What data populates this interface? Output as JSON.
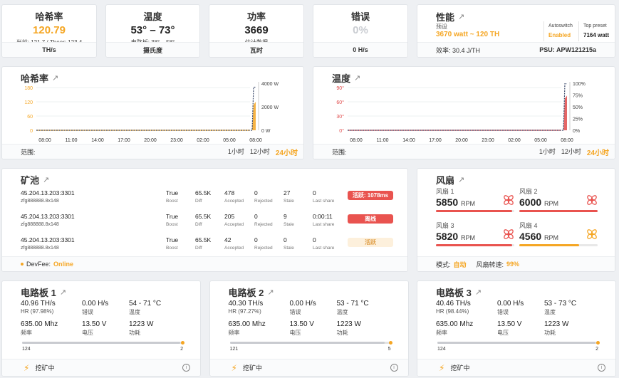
{
  "stats": {
    "hashrate": {
      "title": "哈希率",
      "value": "120.79",
      "sub": "当前: 121.7 / Theor: 123.4",
      "unit": "TH/s"
    },
    "temperature": {
      "title": "温度",
      "value": "53° – 73°",
      "sub": "电路板: 38° – 58°",
      "unit": "摄氏度"
    },
    "power": {
      "title": "功率",
      "value": "3669",
      "sub": "估计数据",
      "unit": "瓦时"
    },
    "errors": {
      "title": "错误",
      "value": "0%",
      "unit": "0 H/s"
    },
    "performance": {
      "title": "性能",
      "preset_label": "预设",
      "preset_value": "3670 watt ~ 120 TH",
      "autoswitch_label": "Autoswitch",
      "autoswitch_value": "Enabled",
      "top_preset_label": "Top preset",
      "top_preset_value": "7164 watt",
      "efficiency": "效率: 30.4 J/TH",
      "psu": "PSU: APW121215a"
    }
  },
  "charts": {
    "hashrate": {
      "title": "哈希率",
      "range_label": "范围:",
      "ranges": [
        "1小时",
        "12小时",
        "24小时"
      ],
      "active_range": "24小时"
    },
    "temperature": {
      "title": "温度",
      "range_label": "范围:",
      "ranges": [
        "1小时",
        "12小时",
        "24小时"
      ],
      "active_range": "24小时"
    }
  },
  "chart_data": [
    {
      "type": "line",
      "x": [
        "08:00",
        "11:00",
        "14:00",
        "17:00",
        "20:00",
        "23:00",
        "02:00",
        "05:00",
        "08:00"
      ],
      "left_ticks": [
        "180",
        "120",
        "60",
        "0"
      ],
      "right_ticks": [
        "4000 W",
        "2000 W",
        "0 W"
      ],
      "ylim_left": [
        0,
        180
      ],
      "ylim_right": [
        0,
        4000
      ],
      "series": [
        {
          "values": [
            0,
            0,
            0,
            0,
            0,
            0,
            0,
            0,
            120
          ],
          "color": "#f5a623"
        },
        {
          "values": [
            0,
            0,
            0,
            0,
            0,
            0,
            0,
            0,
            3669
          ],
          "color": "#3b4a6b"
        }
      ]
    },
    {
      "type": "line",
      "x": [
        "08:00",
        "11:00",
        "14:00",
        "17:00",
        "20:00",
        "23:00",
        "02:00",
        "05:00",
        "08:00"
      ],
      "left_ticks": [
        "90°",
        "60°",
        "30°",
        "0°"
      ],
      "right_ticks": [
        "100%",
        "75%",
        "50%",
        "25%",
        "0%"
      ],
      "ylim_left": [
        0,
        90
      ],
      "ylim_right": [
        0,
        100
      ],
      "series": [
        {
          "values": [
            0,
            0,
            0,
            0,
            0,
            0,
            0,
            0,
            73
          ],
          "color": "#e04b4b"
        },
        {
          "values": [
            0,
            0,
            0,
            0,
            0,
            0,
            0,
            0,
            99
          ],
          "color": "#3b4a6b"
        }
      ]
    }
  ],
  "pools": {
    "title": "矿池",
    "col_labels": {
      "boost": "Boost",
      "diff": "Diff",
      "accepted": "Accepted",
      "rejected": "Rejected",
      "stale": "Stale",
      "last_share": "Last share"
    },
    "rows": [
      {
        "url": "45.204.13.203:3301",
        "user": "zfg888888.8x148",
        "boost": "True",
        "diff": "65.5K",
        "accepted": "478",
        "rejected": "0",
        "stale": "27",
        "last_share": "0",
        "status": "活跃: 1078ms",
        "status_color": "#e9534f"
      },
      {
        "url": "45.204.13.203:3301",
        "user": "zfg888888.8x148",
        "boost": "True",
        "diff": "65.5K",
        "accepted": "205",
        "rejected": "0",
        "stale": "9",
        "last_share": "0:00:11",
        "status": "离线",
        "status_color": "#e9534f"
      },
      {
        "url": "45.204.13.203:3301",
        "user": "zfg888888.8x148",
        "boost": "True",
        "diff": "65.5K",
        "accepted": "42",
        "rejected": "0",
        "stale": "0",
        "last_share": "0",
        "status": "活跃",
        "status_color": "#fdf0dc"
      }
    ],
    "devfee_label": "DevFee:",
    "devfee_value": "Online"
  },
  "fans": {
    "title": "风扇",
    "items": [
      {
        "name": "风扇 1",
        "rpm": "5850",
        "unit": "RPM",
        "level": 0.97,
        "color": "#e9534f"
      },
      {
        "name": "风扇 2",
        "rpm": "6000",
        "unit": "RPM",
        "level": 1.0,
        "color": "#e9534f"
      },
      {
        "name": "风扇 3",
        "rpm": "5820",
        "unit": "RPM",
        "level": 0.97,
        "color": "#e9534f"
      },
      {
        "name": "风扇 4",
        "rpm": "4560",
        "unit": "RPM",
        "level": 0.76,
        "color": "#f5a623"
      }
    ],
    "mode_label": "模式:",
    "mode_value": "自动",
    "speed_label": "风扇转速:",
    "speed_value": "99%"
  },
  "boards": [
    {
      "title": "电路板 1",
      "hr": "40.96 TH/s",
      "hr_label": "HR (97.98%)",
      "err": "0.00 H/s",
      "err_label": "错误",
      "temp": "54 - 71 °C",
      "temp_label": "温度",
      "freq": "635.00 Mhz",
      "freq_label": "频率",
      "volt": "13.50 V",
      "volt_label": "电压",
      "power": "1223 W",
      "power_label": "功耗",
      "chips_lo": "124",
      "chips_hi": "2",
      "status": "挖矿中"
    },
    {
      "title": "电路板 2",
      "hr": "40.30 TH/s",
      "hr_label": "HR (97.27%)",
      "err": "0.00 H/s",
      "err_label": "错误",
      "temp": "53 - 71 °C",
      "temp_label": "温度",
      "freq": "635.00 Mhz",
      "freq_label": "频率",
      "volt": "13.50 V",
      "volt_label": "电压",
      "power": "1223 W",
      "power_label": "功耗",
      "chips_lo": "121",
      "chips_hi": "5",
      "status": "挖矿中"
    },
    {
      "title": "电路板 3",
      "hr": "40.46 TH/s",
      "hr_label": "HR (98.44%)",
      "err": "0.00 H/s",
      "err_label": "错误",
      "temp": "53 - 73 °C",
      "temp_label": "温度",
      "freq": "635.00 Mhz",
      "freq_label": "频率",
      "volt": "13.50 V",
      "volt_label": "电压",
      "power": "1223 W",
      "power_label": "功耗",
      "chips_lo": "124",
      "chips_hi": "2",
      "status": "挖矿中"
    }
  ]
}
